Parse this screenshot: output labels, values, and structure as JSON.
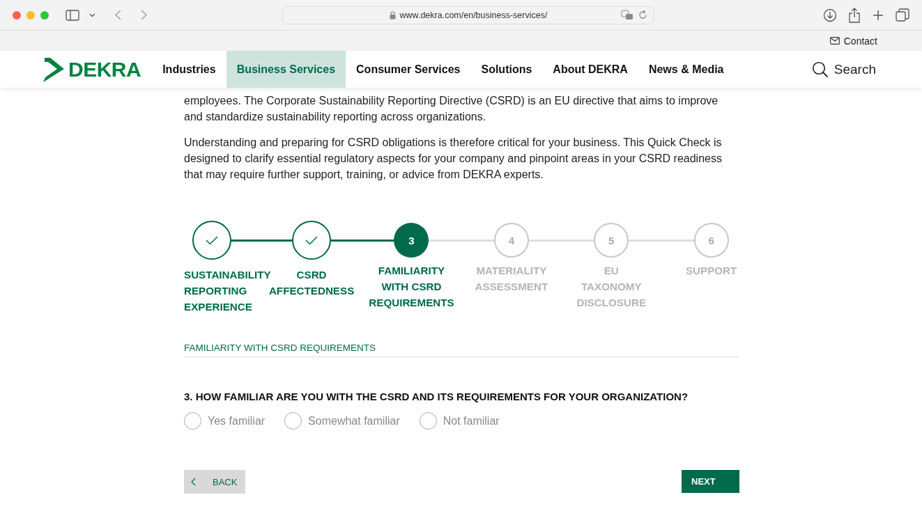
{
  "browser": {
    "url": "www.dekra.com/en/business-services/"
  },
  "topbar": {
    "contact": "Contact"
  },
  "nav": {
    "logo": "DEKRA",
    "items": [
      {
        "label": "Industries",
        "selected": false
      },
      {
        "label": "Business Services",
        "selected": true
      },
      {
        "label": "Consumer Services",
        "selected": false
      },
      {
        "label": "Solutions",
        "selected": false
      },
      {
        "label": "About DEKRA",
        "selected": false
      },
      {
        "label": "News & Media",
        "selected": false
      }
    ],
    "search": "Search"
  },
  "intro": [
    "employees. The Corporate Sustainability Reporting Directive (CSRD) is an EU directive that aims to improve and standardize sustainability reporting across organizations.",
    "Understanding and preparing for CSRD obligations is therefore critical for your business. This Quick Check is designed to clarify essential regulatory aspects for your company and pinpoint areas in your CSRD readiness that may require further support, training, or advice from DEKRA experts."
  ],
  "steps": [
    {
      "kind": "done",
      "label": "SUSTAINABILITY REPORTING EXPERIENCE"
    },
    {
      "kind": "done",
      "label": "CSRD AFFECTEDNESS"
    },
    {
      "kind": "current",
      "number": "3",
      "label": "FAMILIARITY WITH CSRD REQUIREMENTS"
    },
    {
      "kind": "todo",
      "number": "4",
      "label": "MATERIALITY ASSESSMENT"
    },
    {
      "kind": "todo",
      "number": "5",
      "label": "EU TAXONOMY DISCLOSURE"
    },
    {
      "kind": "todo",
      "number": "6",
      "label": "SUPPORT"
    }
  ],
  "section_title": "FAMILIARITY WITH CSRD REQUIREMENTS",
  "question": "3. HOW FAMILIAR ARE YOU WITH THE CSRD AND ITS REQUIREMENTS FOR YOUR ORGANIZATION?",
  "options": [
    {
      "label": "Yes familiar",
      "selected": false
    },
    {
      "label": "Somewhat familiar",
      "selected": false
    },
    {
      "label": "Not familiar",
      "selected": false
    }
  ],
  "buttons": {
    "back": "BACK",
    "next": "NEXT"
  }
}
